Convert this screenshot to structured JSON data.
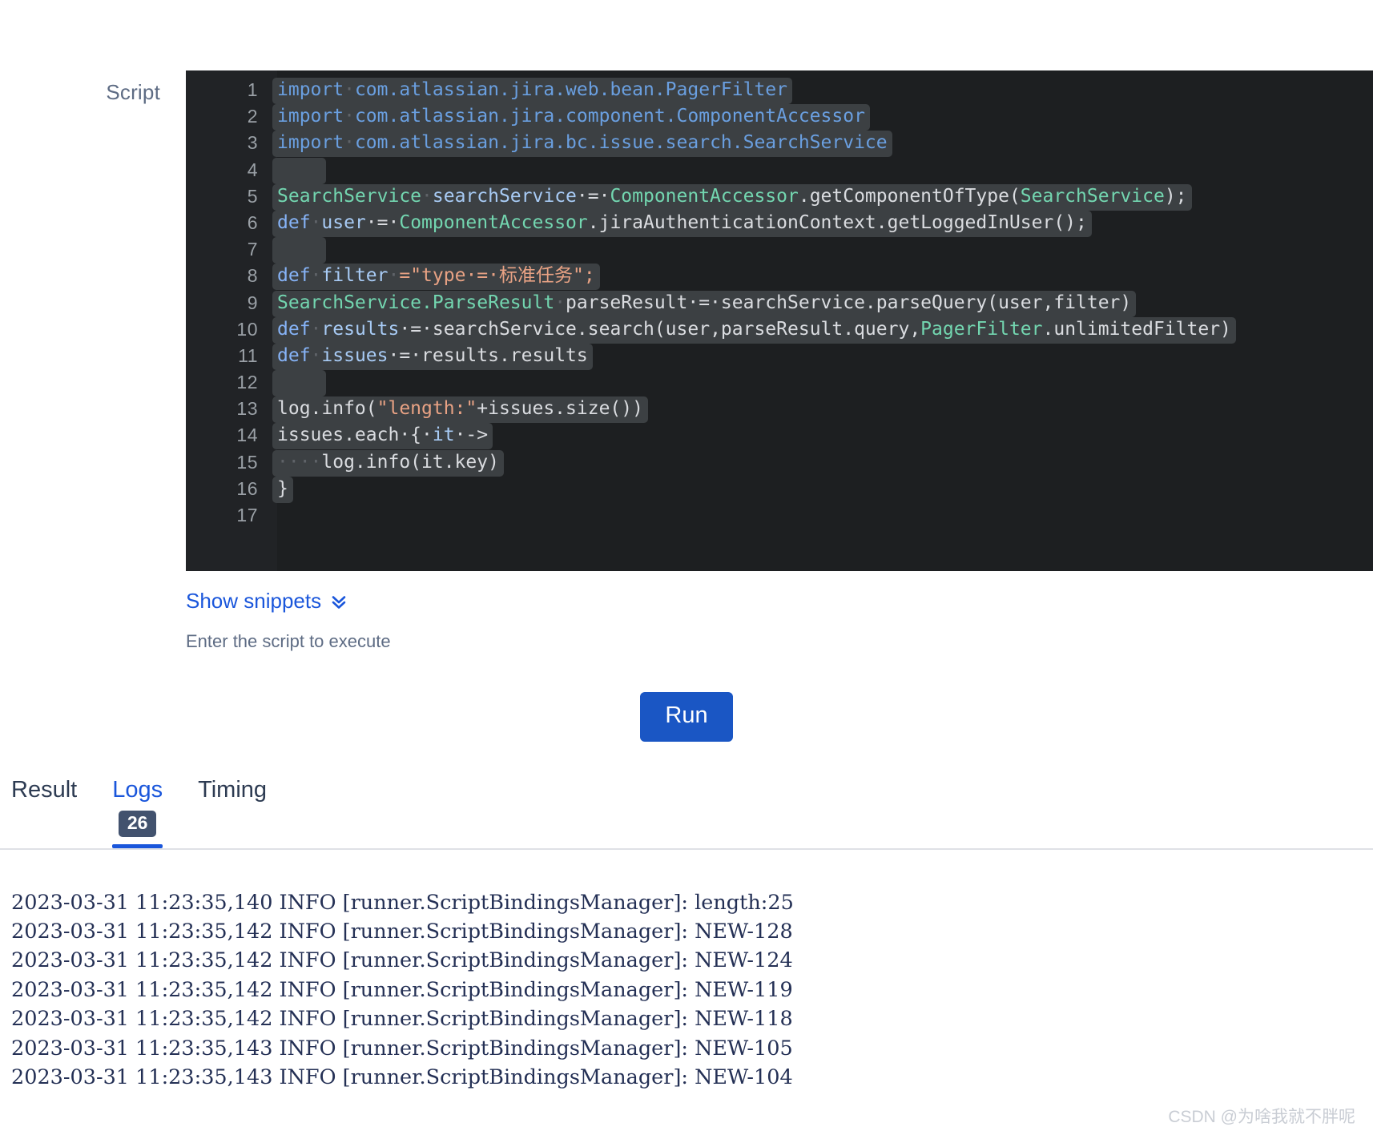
{
  "script": {
    "label": "Script",
    "line_count": 17,
    "lines": [
      {
        "n": "1",
        "segments": [
          {
            "t": "import",
            "c": "imp",
            "hl": true
          },
          {
            "t": "·",
            "c": "ws",
            "hl": true
          },
          {
            "t": "com.atlassian.jira.web.bean.PagerFilter",
            "c": "imp",
            "hl": true
          }
        ]
      },
      {
        "n": "2",
        "segments": [
          {
            "t": "import",
            "c": "imp",
            "hl": true
          },
          {
            "t": "·",
            "c": "ws",
            "hl": true
          },
          {
            "t": "com.atlassian.jira.component.ComponentAccessor",
            "c": "imp",
            "hl": true
          }
        ]
      },
      {
        "n": "3",
        "segments": [
          {
            "t": "import",
            "c": "imp",
            "hl": true
          },
          {
            "t": "·",
            "c": "ws",
            "hl": true
          },
          {
            "t": "com.atlassian.jira.bc.issue.search.SearchService",
            "c": "imp",
            "hl": true
          }
        ]
      },
      {
        "n": "4",
        "segments": [
          {
            "t": "    ",
            "c": "plain",
            "hl": true
          }
        ]
      },
      {
        "n": "5",
        "segments": [
          {
            "t": "SearchService",
            "c": "type",
            "hl": true
          },
          {
            "t": "·",
            "c": "ws",
            "hl": true
          },
          {
            "t": "searchService",
            "c": "var",
            "hl": true
          },
          {
            "t": "·=·",
            "c": "plain",
            "hl": true
          },
          {
            "t": "ComponentAccessor",
            "c": "type",
            "hl": true
          },
          {
            "t": ".getComponentOfType(",
            "c": "plain",
            "hl": true
          },
          {
            "t": "SearchService",
            "c": "type",
            "hl": true
          },
          {
            "t": ");",
            "c": "plain",
            "hl": true
          }
        ]
      },
      {
        "n": "6",
        "segments": [
          {
            "t": "def",
            "c": "kw",
            "hl": true
          },
          {
            "t": "·",
            "c": "ws",
            "hl": true
          },
          {
            "t": "user",
            "c": "var",
            "hl": true
          },
          {
            "t": "·=·",
            "c": "plain",
            "hl": true
          },
          {
            "t": "ComponentAccessor",
            "c": "type",
            "hl": true
          },
          {
            "t": ".jiraAuthenticationContext.getLoggedInUser();",
            "c": "plain",
            "hl": true
          }
        ]
      },
      {
        "n": "7",
        "segments": [
          {
            "t": "    ",
            "c": "plain",
            "hl": true
          }
        ]
      },
      {
        "n": "8",
        "segments": [
          {
            "t": "def",
            "c": "kw",
            "hl": true
          },
          {
            "t": "·",
            "c": "ws",
            "hl": true
          },
          {
            "t": "filter",
            "c": "var",
            "hl": true
          },
          {
            "t": "·",
            "c": "ws",
            "hl": true
          },
          {
            "t": "=\"type·=·标准任务\";",
            "c": "str",
            "hl": true
          }
        ]
      },
      {
        "n": "9",
        "segments": [
          {
            "t": "SearchService.ParseResult",
            "c": "type",
            "hl": true
          },
          {
            "t": "·",
            "c": "ws",
            "hl": true
          },
          {
            "t": "parseResult·=·searchService.parseQuery(user,filter)",
            "c": "plain",
            "hl": true
          }
        ]
      },
      {
        "n": "10",
        "segments": [
          {
            "t": "def",
            "c": "kw",
            "hl": true
          },
          {
            "t": "·",
            "c": "ws",
            "hl": true
          },
          {
            "t": "results",
            "c": "var",
            "hl": true
          },
          {
            "t": "·=·searchService.search(user,parseResult.query,",
            "c": "plain",
            "hl": true
          },
          {
            "t": "PagerFilter",
            "c": "type",
            "hl": true
          },
          {
            "t": ".unlimitedFilter)",
            "c": "plain",
            "hl": true
          }
        ]
      },
      {
        "n": "11",
        "segments": [
          {
            "t": "def",
            "c": "kw",
            "hl": true
          },
          {
            "t": "·",
            "c": "ws",
            "hl": true
          },
          {
            "t": "issues",
            "c": "var",
            "hl": true
          },
          {
            "t": "·=·results.results",
            "c": "plain",
            "hl": true
          }
        ]
      },
      {
        "n": "12",
        "segments": [
          {
            "t": "    ",
            "c": "plain",
            "hl": true
          }
        ]
      },
      {
        "n": "13",
        "segments": [
          {
            "t": "log.info(",
            "c": "plain",
            "hl": true
          },
          {
            "t": "\"length:\"",
            "c": "str",
            "hl": true
          },
          {
            "t": "+issues.size())",
            "c": "plain",
            "hl": true
          }
        ]
      },
      {
        "n": "14",
        "segments": [
          {
            "t": "issues.each·{·",
            "c": "plain",
            "hl": true
          },
          {
            "t": "it",
            "c": "var",
            "hl": true
          },
          {
            "t": "·->",
            "c": "plain",
            "hl": true
          }
        ]
      },
      {
        "n": "15",
        "segments": [
          {
            "t": "····",
            "c": "ws",
            "hl": true
          },
          {
            "t": "log.info(it.key)",
            "c": "plain",
            "hl": true
          }
        ]
      },
      {
        "n": "16",
        "segments": [
          {
            "t": "}",
            "c": "plain",
            "hl": true
          }
        ]
      },
      {
        "n": "17",
        "segments": []
      }
    ]
  },
  "snippets": {
    "label": "Show snippets",
    "icon": "chevron-double-down-icon"
  },
  "hint": "Enter the script to execute",
  "run": {
    "label": "Run",
    "color": "#1a56c4"
  },
  "tabs": [
    {
      "label": "Result",
      "active": false,
      "badge": null
    },
    {
      "label": "Logs",
      "active": true,
      "badge": "26"
    },
    {
      "label": "Timing",
      "active": false,
      "badge": null
    }
  ],
  "logs": [
    "2023-03-31 11:23:35,140 INFO [runner.ScriptBindingsManager]: length:25",
    "2023-03-31 11:23:35,142 INFO [runner.ScriptBindingsManager]: NEW-128",
    "2023-03-31 11:23:35,142 INFO [runner.ScriptBindingsManager]: NEW-124",
    "2023-03-31 11:23:35,142 INFO [runner.ScriptBindingsManager]: NEW-119",
    "2023-03-31 11:23:35,142 INFO [runner.ScriptBindingsManager]: NEW-118",
    "2023-03-31 11:23:35,143 INFO [runner.ScriptBindingsManager]: NEW-105",
    "2023-03-31 11:23:35,143 INFO [runner.ScriptBindingsManager]: NEW-104"
  ],
  "watermark": "CSDN @为啥我就不胖呢"
}
